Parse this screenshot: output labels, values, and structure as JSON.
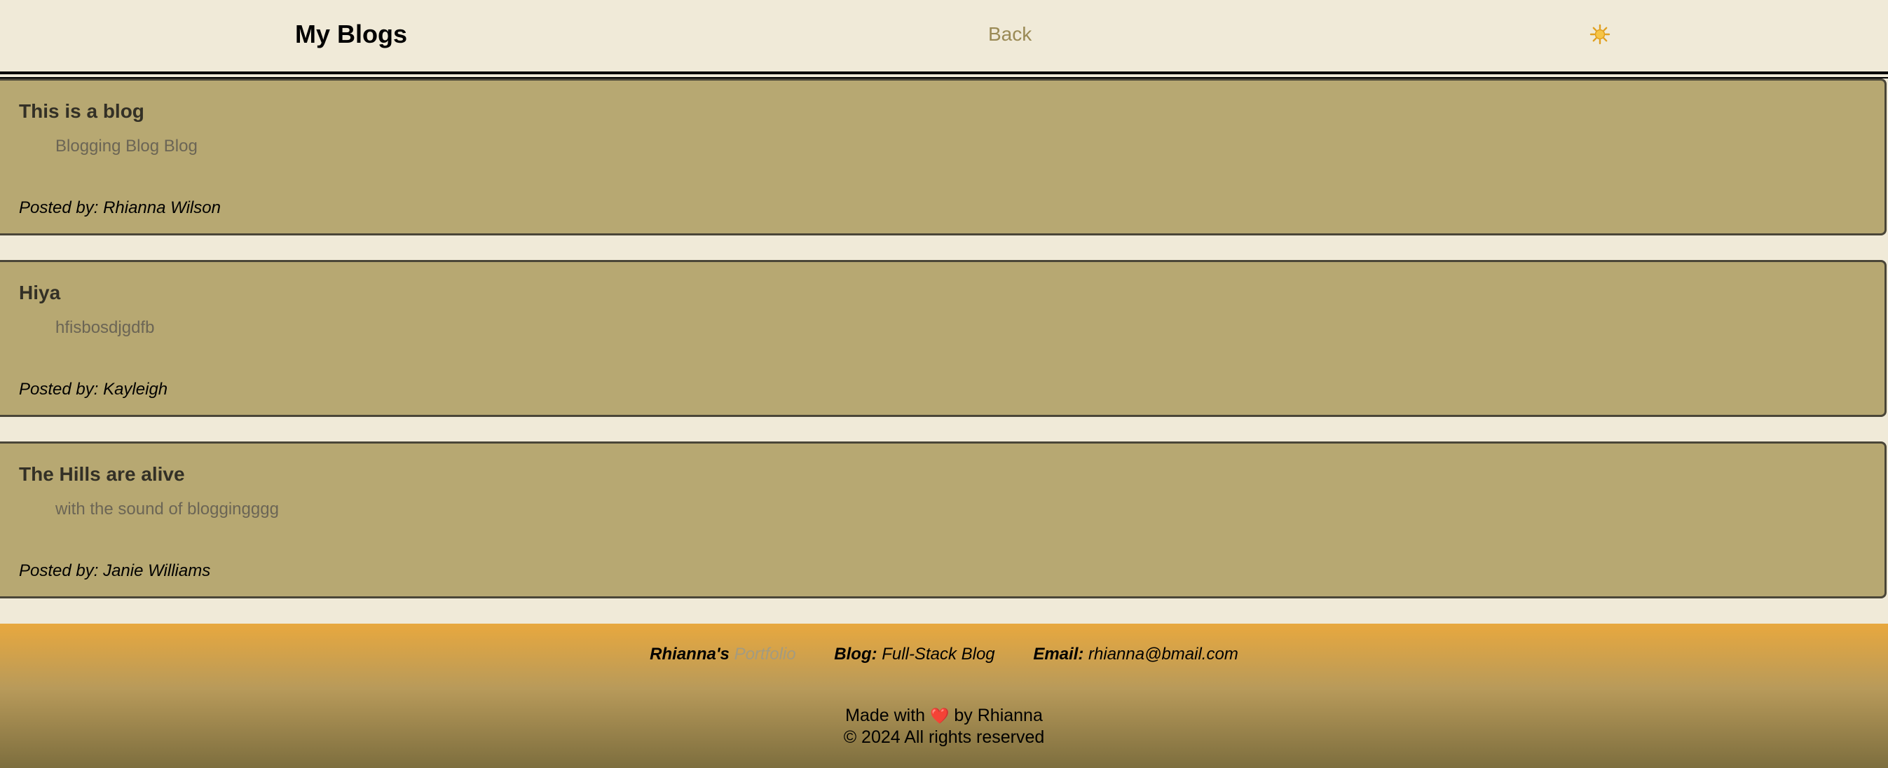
{
  "header": {
    "title": "My Blogs",
    "back_label": "Back",
    "theme_icon": "sun-icon"
  },
  "posts": [
    {
      "title": "This is a blog",
      "body": "Blogging Blog Blog",
      "author": "Posted by: Rhianna Wilson"
    },
    {
      "title": "Hiya",
      "body": "hfisbosdjgdfb",
      "author": "Posted by: Kayleigh"
    },
    {
      "title": "The Hills are alive",
      "body": "with the sound of bloggingggg",
      "author": "Posted by: Janie Williams"
    }
  ],
  "footer": {
    "owner": "Rhianna's",
    "portfolio_label": "Portfolio",
    "blog_label": "Blog:",
    "blog_value": "Full-Stack Blog",
    "email_label": "Email:",
    "email_value": "rhianna@bmail.com",
    "made_with_prefix": "Made with",
    "heart": "❤️",
    "made_with_suffix": "by Rhianna",
    "copyright": "© 2024 All rights reserved"
  },
  "colors": {
    "background": "#f0ead8",
    "card": "#b7a872",
    "accent": "#e8a83e",
    "link": "#9a8a55"
  }
}
